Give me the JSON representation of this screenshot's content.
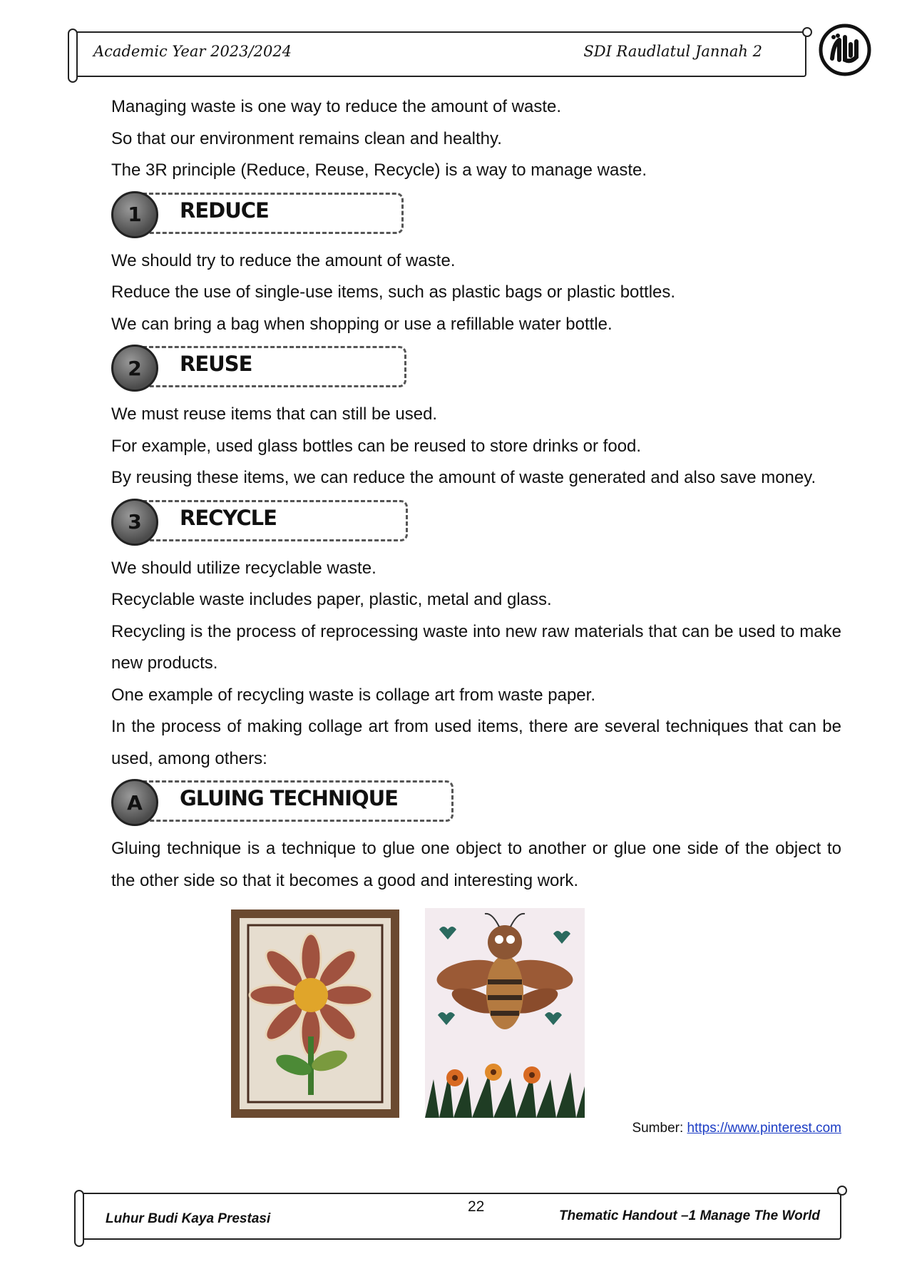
{
  "header": {
    "left": "Academic Year 2023/2024",
    "right": "SDI Raudlatul Jannah 2",
    "logo_icon": "school-logo"
  },
  "intro": [
    "Managing waste is one way to reduce the amount of waste.",
    "So that our environment remains clean and healthy.",
    "The 3R principle (Reduce, Reuse, Recycle) is a way to manage waste."
  ],
  "sections": [
    {
      "badge": "1",
      "title": "REDUCE",
      "lines": [
        "We should try to reduce the amount of waste.",
        "Reduce the use of single-use items, such as plastic bags or plastic bottles.",
        "We can bring a bag when shopping or use a refillable water bottle."
      ]
    },
    {
      "badge": "2",
      "title": "REUSE",
      "lines": [
        "We must reuse items that can still be used.",
        "For example, used glass bottles can be reused to store drinks or food.",
        "By reusing these items, we can reduce the amount of waste generated and also save money."
      ]
    },
    {
      "badge": "3",
      "title": "RECYCLE",
      "lines": [
        "We should utilize recyclable waste.",
        "Recyclable waste includes paper, plastic, metal and glass.",
        "Recycling is the process of reprocessing waste into new raw materials that can be used to make new products.",
        "One example of recycling waste is collage art from waste paper.",
        "In the process of making collage art from used items, there are several techniques that can be used, among others:"
      ]
    },
    {
      "badge": "A",
      "title": "GLUING TECHNIQUE",
      "lines": [
        "Gluing technique is a technique to glue one object to another or glue one side of the object to the other side so that it becomes a good and interesting work."
      ]
    }
  ],
  "images": {
    "left": "flower-collage-image",
    "right": "bee-collage-image"
  },
  "source": {
    "label": "Sumber: ",
    "link": "https://www.pinterest.com"
  },
  "footer": {
    "left": "Luhur Budi Kaya Prestasi",
    "page_number": "22",
    "right": "Thematic Handout –1 Manage The World"
  }
}
